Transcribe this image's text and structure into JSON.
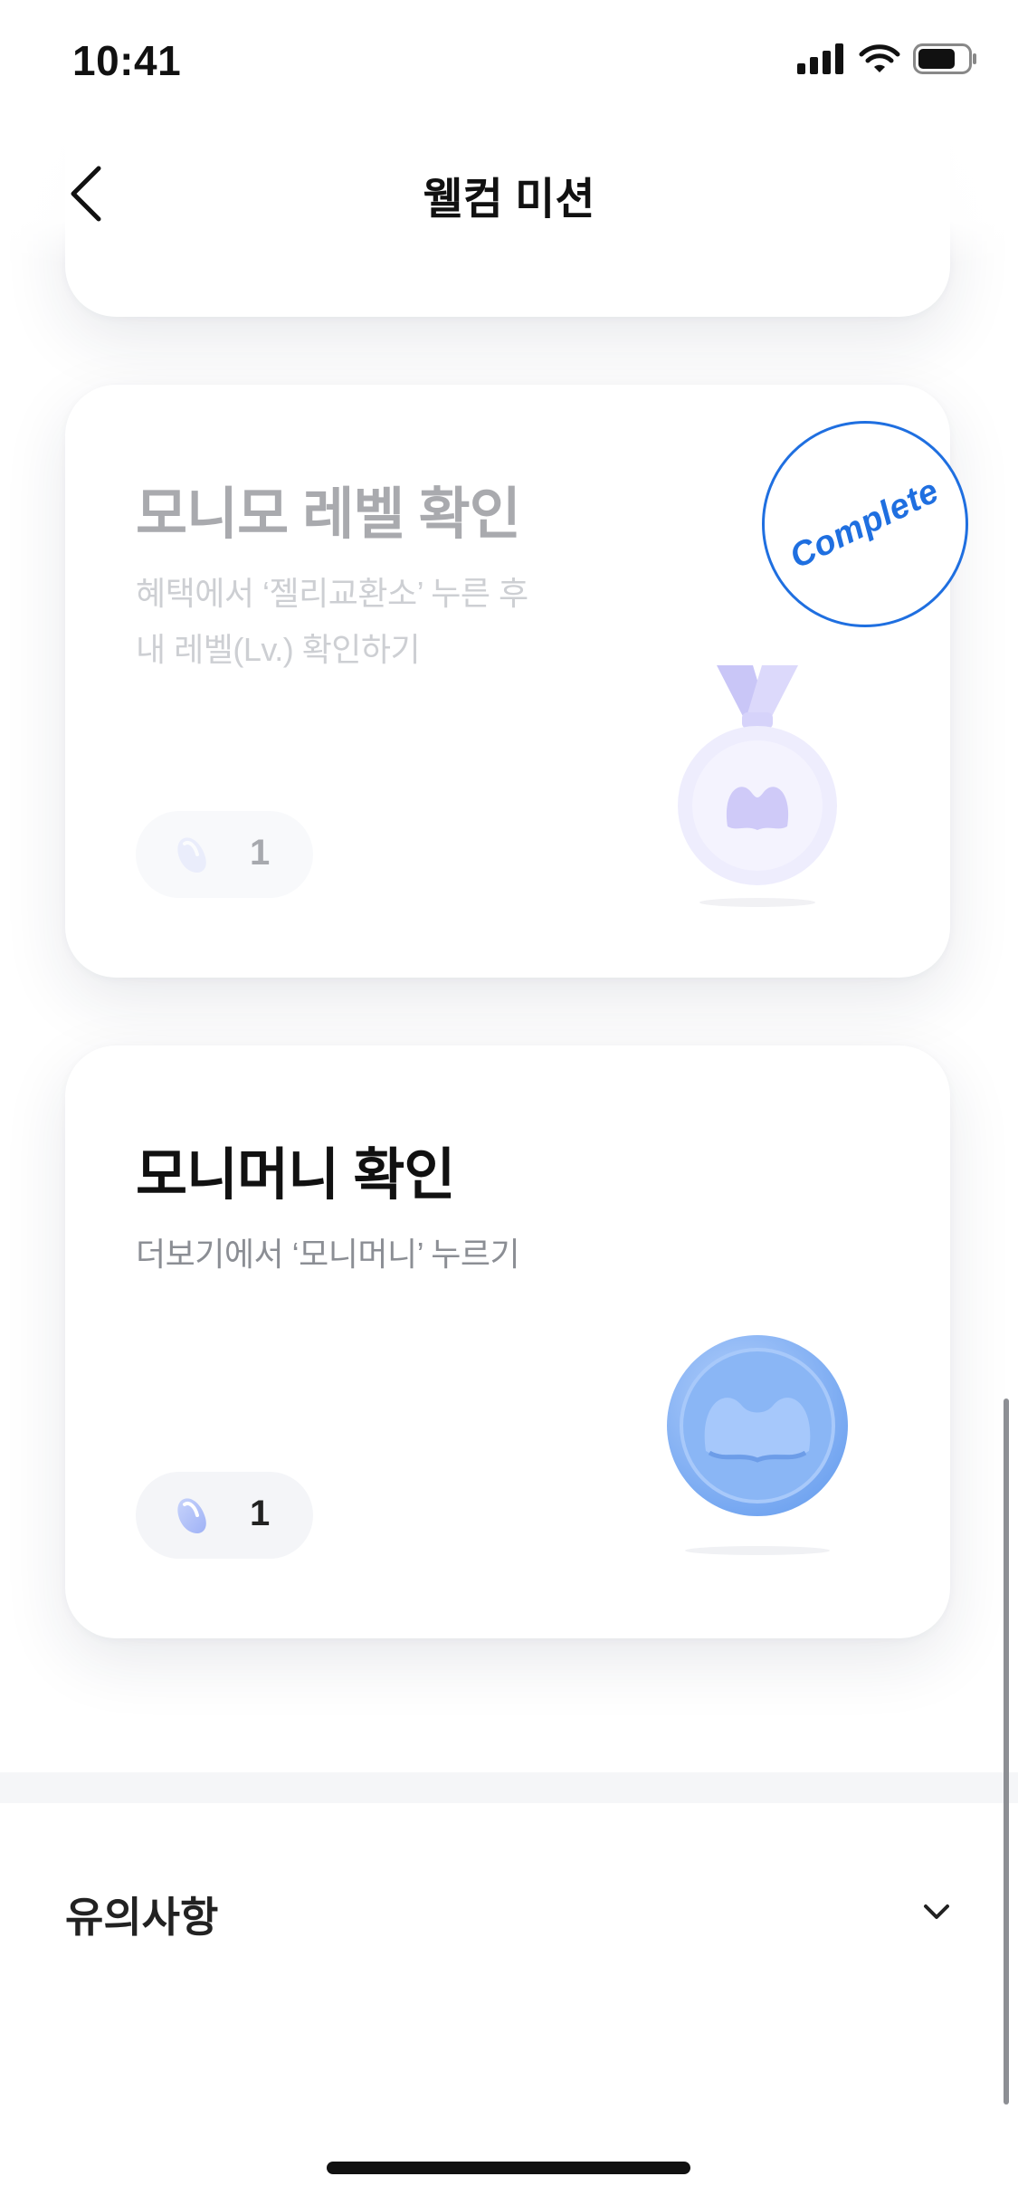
{
  "status_bar": {
    "time": "10:41"
  },
  "nav": {
    "title": "웰컴 미션"
  },
  "missions": [
    {
      "title": "모니모 레벨 확인",
      "desc_line1": "혜택에서 ‘젤리교환소’ 누른 후",
      "desc_line2": "내 레벨(Lv.) 확인하기",
      "reward": "1",
      "stamp": "Complete",
      "status": "completed",
      "icon": "medal-icon"
    },
    {
      "title": "모니머니 확인",
      "desc_line1": "더보기에서 ‘모니머니’ 누르기",
      "reward": "1",
      "status": "active",
      "icon": "coin-icon"
    }
  ],
  "notice": {
    "title": "유의사항",
    "icon": "chevron-down-icon"
  },
  "colors": {
    "accent": "#1f6fe0",
    "coin": "#8fb7f5",
    "medal": "#e9e8ff"
  }
}
